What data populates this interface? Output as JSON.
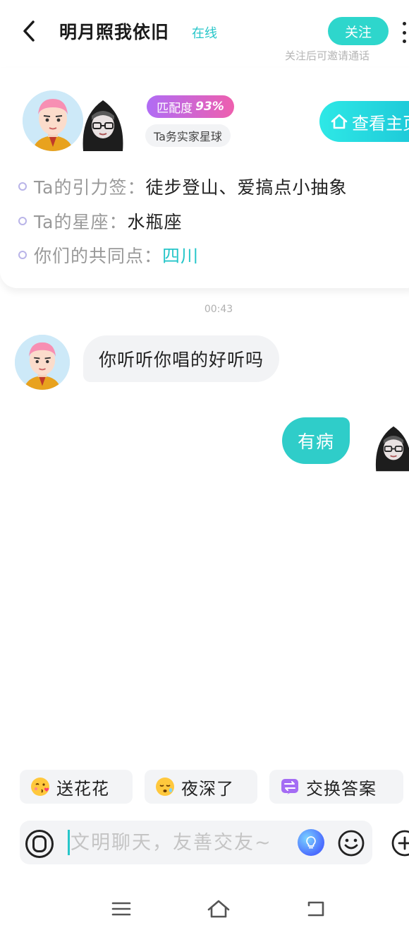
{
  "header": {
    "title": "明月照我依旧",
    "status": "在线",
    "follow_label": "关注",
    "follow_hint": "关注后可邀请通话"
  },
  "profile": {
    "match_label": "匹配度",
    "match_value": "93%",
    "planet_tag": "Ta务实家星球",
    "home_button_label": "查看主页",
    "info": [
      {
        "label": "Ta的引力签：",
        "value": "徒步登山、爱搞点小抽象"
      },
      {
        "label": "Ta的星座：",
        "value": "水瓶座"
      },
      {
        "label": "你们的共同点：",
        "value": "四川"
      }
    ]
  },
  "chat": {
    "timestamp": "00:43",
    "messages": [
      {
        "side": "left",
        "text": "你听听你唱的好听吗"
      },
      {
        "side": "right",
        "text": "有病"
      }
    ]
  },
  "quick_replies": [
    {
      "icon": "kiss-face-icon",
      "label": "送花花"
    },
    {
      "icon": "sleepy-face-icon",
      "label": "夜深了"
    },
    {
      "icon": "swap-icon",
      "label": "交换答案"
    }
  ],
  "input": {
    "placeholder": "文明聊天，友善交友~",
    "value": ""
  },
  "colors": {
    "accent": "#2fcdc9",
    "match_gradient_start": "#b06cf5",
    "match_gradient_end": "#ee5fae"
  }
}
